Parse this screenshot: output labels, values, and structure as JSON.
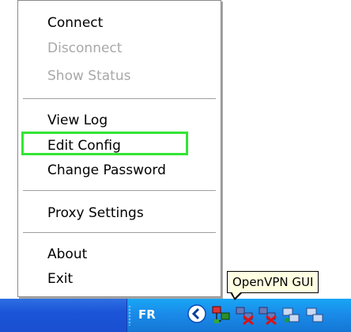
{
  "menu": {
    "items": [
      {
        "label": "Connect",
        "enabled": true
      },
      {
        "label": "Disconnect",
        "enabled": false
      },
      {
        "label": "Show Status",
        "enabled": false
      },
      {
        "label": "View Log",
        "enabled": true
      },
      {
        "label": "Edit Config",
        "enabled": true,
        "highlighted": true
      },
      {
        "label": "Change Password",
        "enabled": true
      },
      {
        "label": "Proxy Settings",
        "enabled": true
      },
      {
        "label": "About",
        "enabled": true
      },
      {
        "label": "Exit",
        "enabled": true
      }
    ]
  },
  "taskbar": {
    "language": "FR",
    "tray_icons": [
      "openvpn-connected-icon",
      "openvpn-disconnected-icon",
      "openvpn-disconnected-icon",
      "network-icon",
      "network-icon"
    ]
  },
  "tooltip": {
    "text": "OpenVPN GUI"
  },
  "colors": {
    "highlight_border": "#33e533",
    "disabled_text": "#a8a8a8",
    "tooltip_bg": "#ffffe1",
    "taskbar_blue": "#1b55d8",
    "tray_blue": "#1a8be9"
  }
}
